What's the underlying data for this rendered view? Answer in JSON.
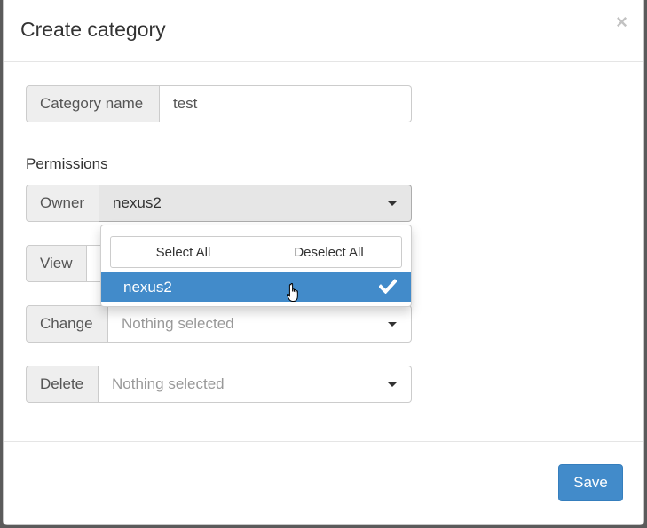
{
  "modal": {
    "title": "Create category",
    "close_symbol": "×"
  },
  "form": {
    "category_name": {
      "label": "Category name",
      "value": "test"
    },
    "permissions_label": "Permissions",
    "owner": {
      "label": "Owner",
      "selected": "nexus2"
    },
    "view": {
      "label": "View"
    },
    "change": {
      "label": "Change",
      "placeholder": "Nothing selected"
    },
    "delete": {
      "label": "Delete",
      "placeholder": "Nothing selected"
    }
  },
  "dropdown": {
    "select_all_label": "Select All",
    "deselect_all_label": "Deselect All",
    "options": [
      {
        "label": "nexus2",
        "selected": true
      }
    ]
  },
  "footer": {
    "save_label": "Save"
  },
  "colors": {
    "primary": "#428bca",
    "addon_bg": "#eeeeee",
    "border": "#cccccc",
    "placeholder": "#999999"
  },
  "icons": {
    "close": "close-icon",
    "caret": "caret-down-icon",
    "check": "check-icon",
    "cursor": "hand-pointer-icon"
  }
}
